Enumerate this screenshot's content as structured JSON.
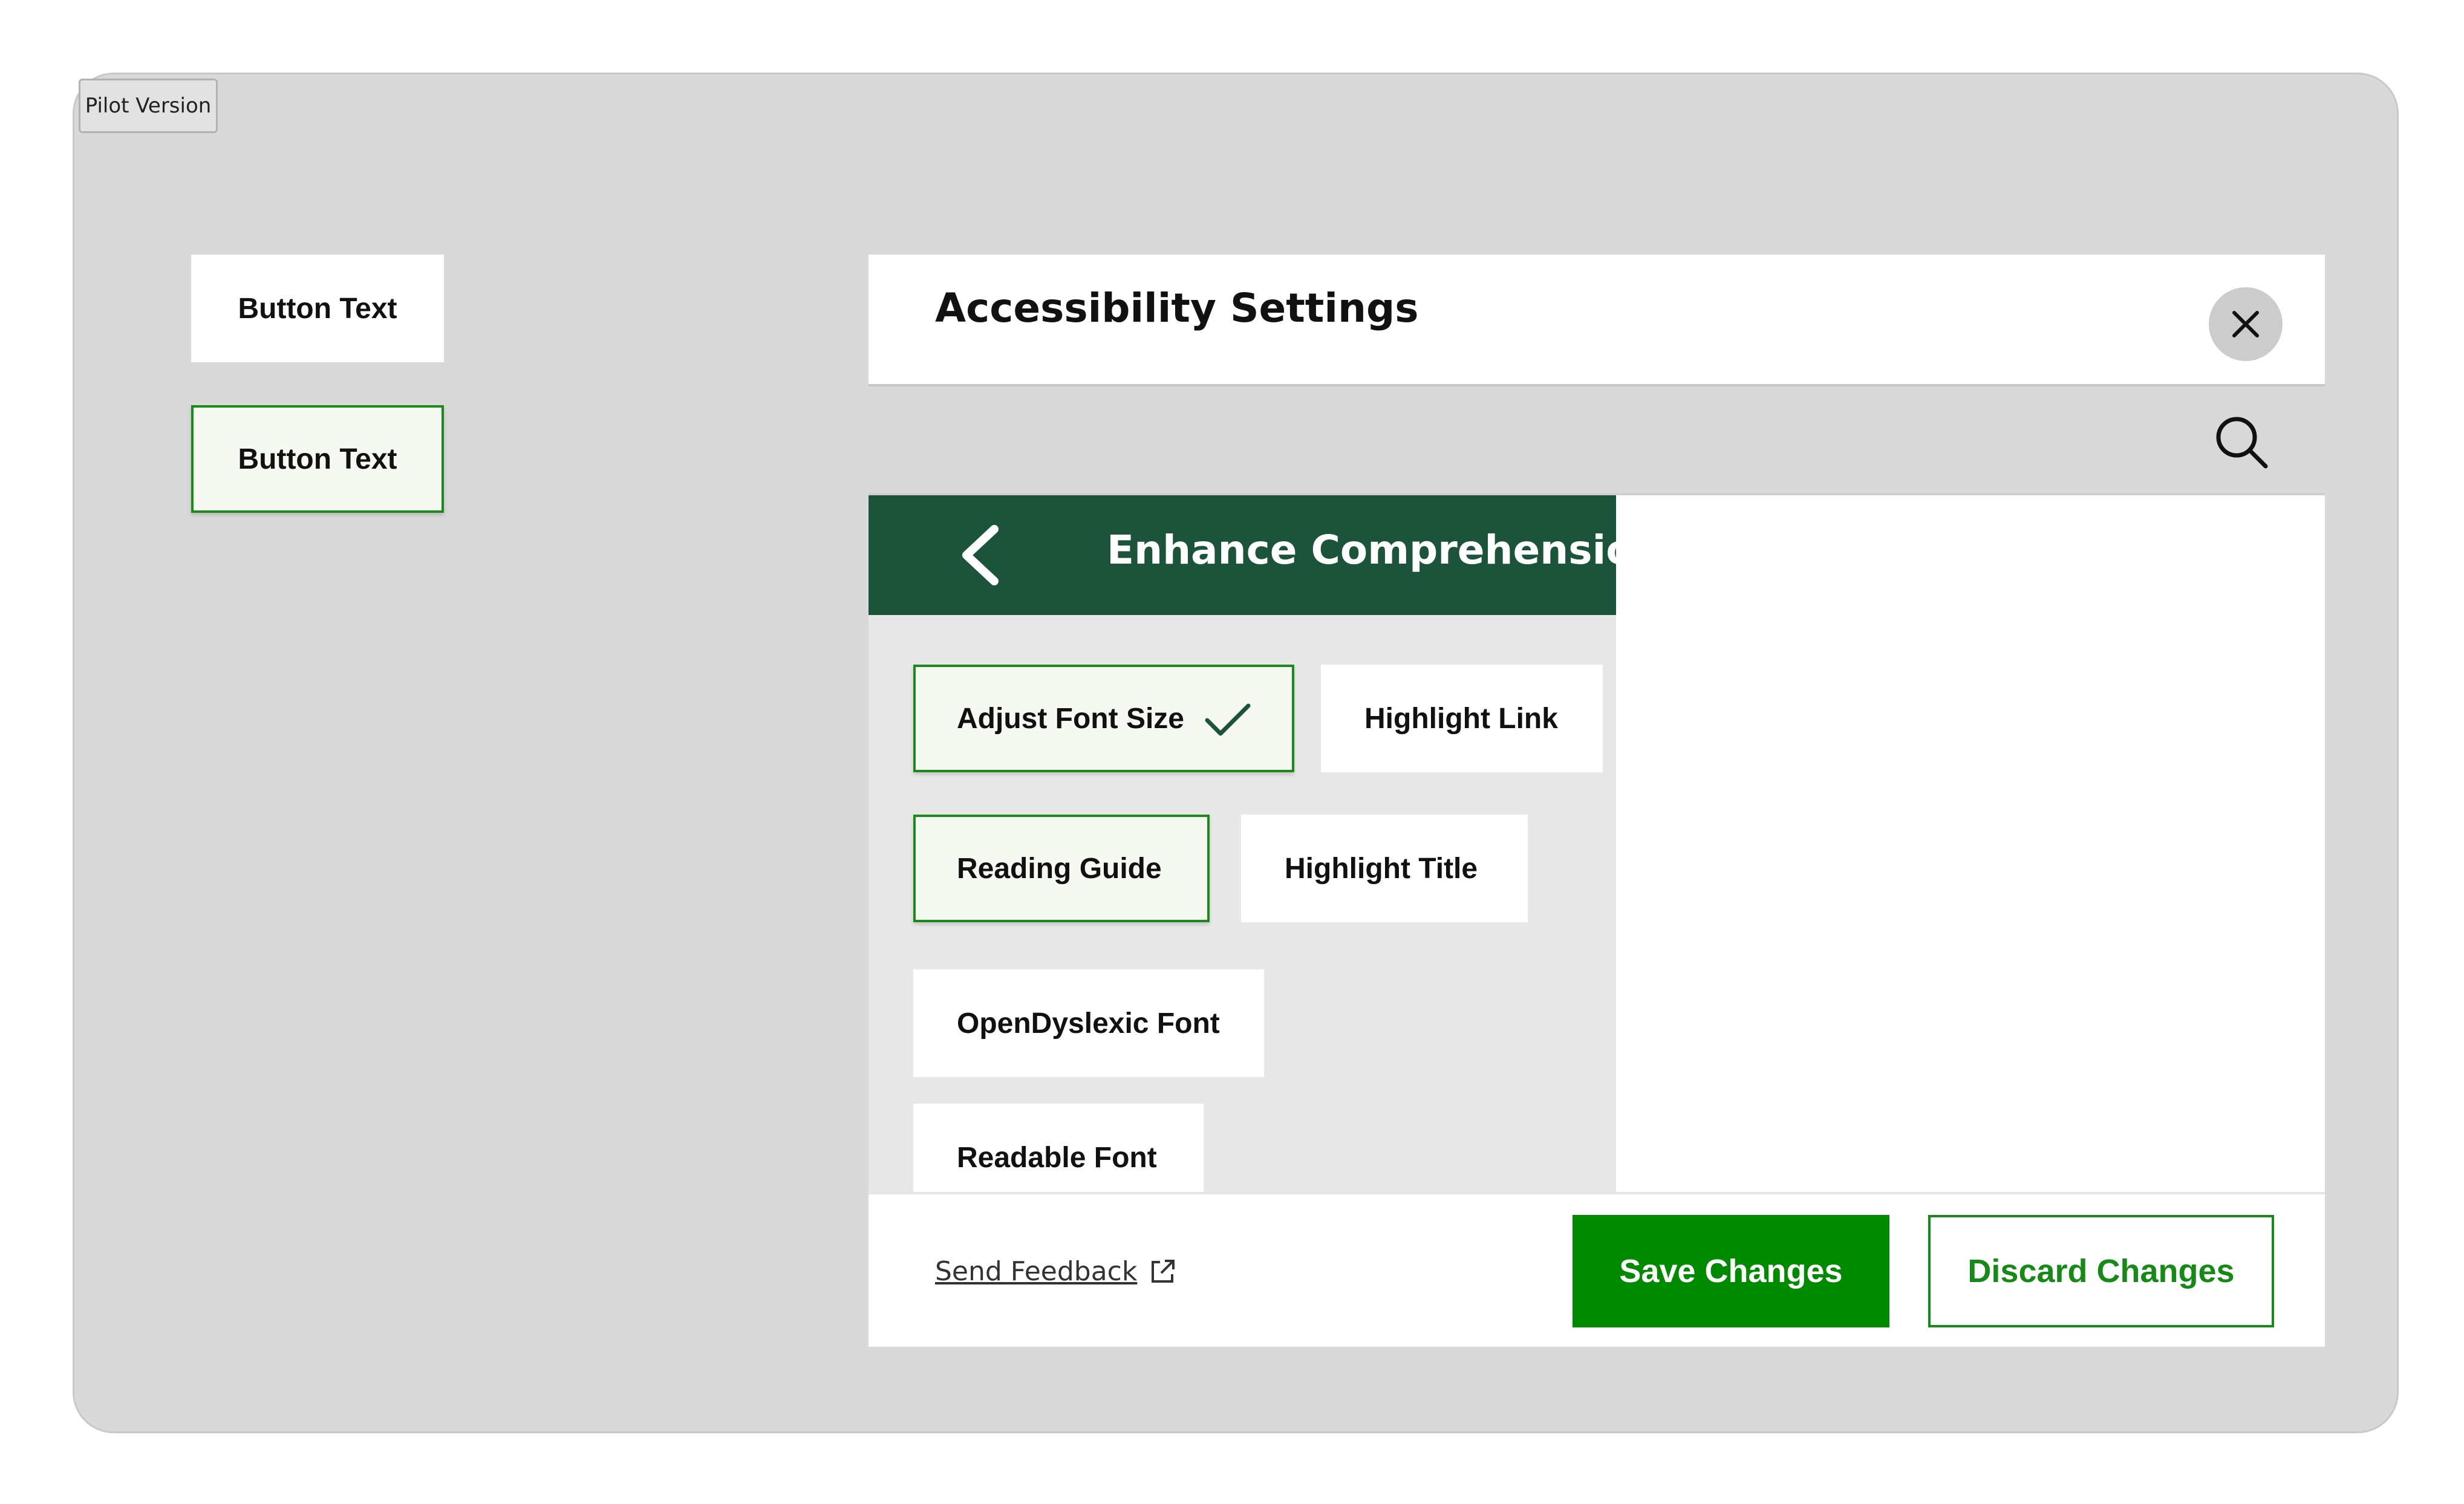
{
  "badge": {
    "label": "Pilot Version"
  },
  "demo_buttons": {
    "default_label": "Button Text",
    "selected_label": "Button Text"
  },
  "panel": {
    "title": "Accessibility Settings",
    "close_icon": "close-icon",
    "search_icon": "search-icon"
  },
  "section": {
    "title": "Enhance Comprehension",
    "back_icon": "chevron-left-icon"
  },
  "options": [
    {
      "label": "Adjust Font Size",
      "selected": true,
      "checked": true
    },
    {
      "label": "Highlight Link",
      "selected": false
    },
    {
      "label": "Reading Guide",
      "selected": true
    },
    {
      "label": "Highlight Title",
      "selected": false
    },
    {
      "label": "OpenDyslexic Font",
      "selected": false
    },
    {
      "label": "Readable Font",
      "selected": false
    }
  ],
  "footer": {
    "feedback_label": "Send Feedback",
    "save_label": "Save Changes",
    "discard_label": "Discard Changes"
  },
  "colors": {
    "frame_bg": "#d9d9d9",
    "section_header_bg": "#1c533b",
    "accent_green": "#008a00",
    "selected_border": "#1b8a1b",
    "selected_bg": "#f6f9f2"
  }
}
